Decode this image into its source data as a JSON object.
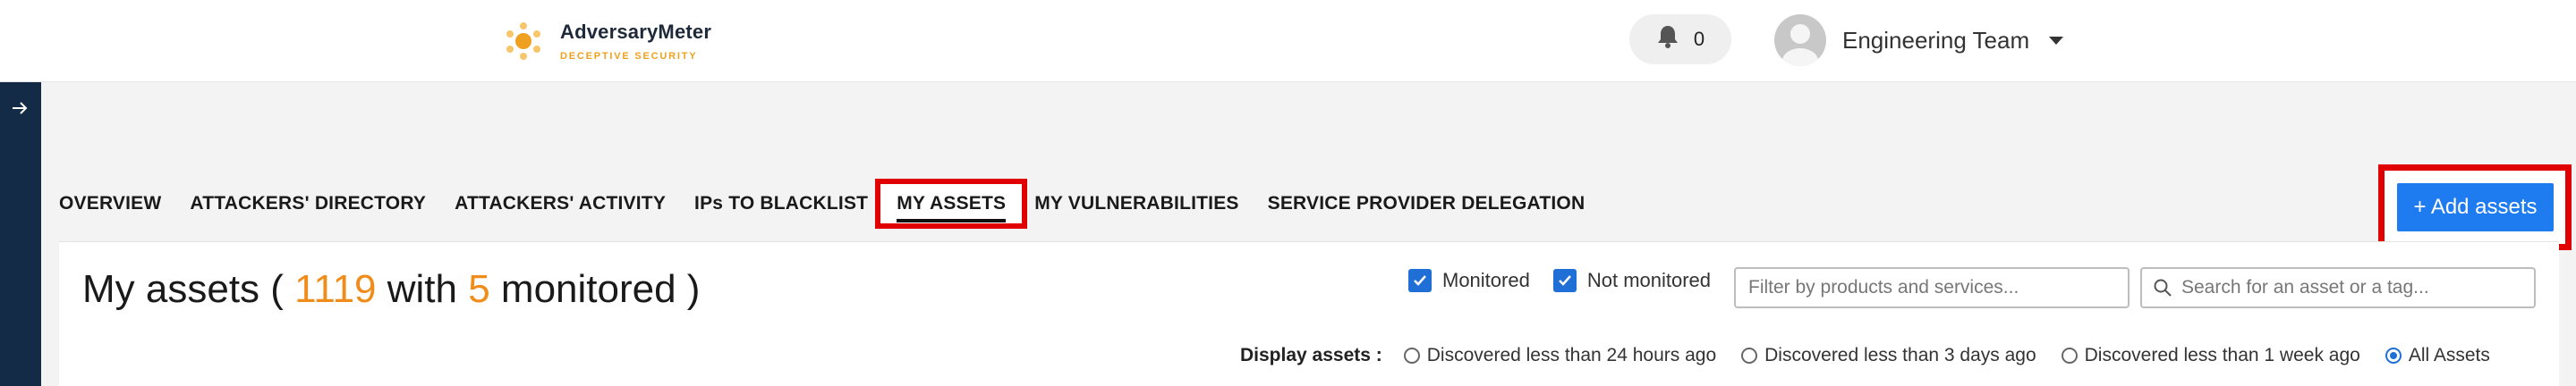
{
  "brand": {
    "name": "AdversaryMeter",
    "tagline": "DECEPTIVE SECURITY",
    "accent": "#f0a020"
  },
  "header": {
    "notifications_count": "0",
    "user_name": "Engineering Team"
  },
  "tabs": [
    {
      "label": "OVERVIEW"
    },
    {
      "label": "ATTACKERS' DIRECTORY"
    },
    {
      "label": "ATTACKERS' ACTIVITY"
    },
    {
      "label": "IPs TO BLACKLIST"
    },
    {
      "label": "MY ASSETS",
      "active": true
    },
    {
      "label": "MY VULNERABILITIES"
    },
    {
      "label": "SERVICE PROVIDER DELEGATION"
    }
  ],
  "actions": {
    "add_assets_label": "+ Add assets"
  },
  "page": {
    "title_prefix": "My assets ( ",
    "total": "1119",
    "with": " with ",
    "monitored_count": "5",
    "title_suffix": " monitored )"
  },
  "filters": {
    "monitored_label": "Monitored",
    "not_monitored_label": "Not monitored",
    "monitored_checked": true,
    "not_monitored_checked": true,
    "products_placeholder": "Filter by products and services...",
    "search_placeholder": "Search for an asset or a tag..."
  },
  "display": {
    "label": "Display assets :",
    "options": [
      {
        "label": "Discovered less than 24 hours ago",
        "selected": false
      },
      {
        "label": "Discovered less than 3 days ago",
        "selected": false
      },
      {
        "label": "Discovered less than 1 week ago",
        "selected": false
      },
      {
        "label": "All Assets",
        "selected": true
      }
    ]
  },
  "colors": {
    "highlight": "#e00000",
    "primary": "#1f7bf0",
    "number": "#f08c1a",
    "rail": "#142b47"
  }
}
